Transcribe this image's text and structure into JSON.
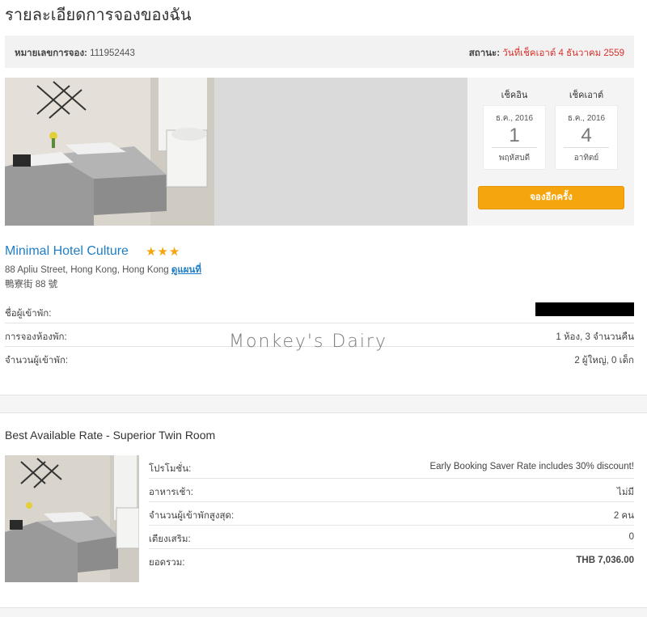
{
  "page": {
    "title": "รายละเอียดการจองของฉัน"
  },
  "booking": {
    "number_label": "หมายเลขการจอง:",
    "number": "111952443",
    "status_label": "สถานะ:",
    "status": "วันที่เช็คเอาต์ 4 ธันวาคม 2559",
    "status_color": "#d9302c"
  },
  "dates": {
    "checkin": {
      "label": "เช็คอิน",
      "month": "ธ.ค., 2016",
      "day": "1",
      "weekday": "พฤหัสบดี"
    },
    "checkout": {
      "label": "เช็คเอาต์",
      "month": "ธ.ค., 2016",
      "day": "4",
      "weekday": "อาทิตย์"
    },
    "rebook_label": "จองอีกครั้ง",
    "rebook_color": "#f5a60e"
  },
  "hotel": {
    "name": "Minimal Hotel Culture",
    "stars": "★★★",
    "star_rating": 3,
    "address": "88 Apliu Street, Hong Kong, Hong Kong",
    "map_link": "ดูแผนที่",
    "address_local": "鴨寮街 88 號",
    "name_color": "#1f7ec6"
  },
  "details": [
    {
      "label": "ชื่อผู้เข้าพัก:",
      "value": ""
    },
    {
      "label": "การจองห้องพัก:",
      "value": "1 ห้อง, 3 จำนวนคืน"
    },
    {
      "label": "จำนวนผู้เข้าพัก:",
      "value": "2 ผู้ใหญ่, 0 เด็ก"
    }
  ],
  "watermark": "Monkey's Dairy",
  "room": {
    "title": "Best Available Rate - Superior Twin Room",
    "rows": [
      {
        "label": "โปรโมชั่น:",
        "value": "Early Booking Saver Rate includes 30% discount!"
      },
      {
        "label": "อาหารเช้า:",
        "value": "ไม่มี"
      },
      {
        "label": "จำนวนผู้เข้าพักสูงสุด:",
        "value": "2 คน"
      },
      {
        "label": "เตียงเสริม:",
        "value": "0"
      },
      {
        "label": "ยอดรวม:",
        "value": "THB 7,036.00"
      }
    ]
  }
}
